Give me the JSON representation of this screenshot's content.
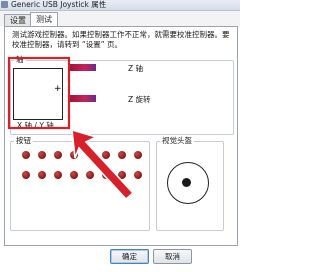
{
  "window": {
    "title": "Generic  USB  Joystick  属性",
    "icon": "gamepad-icon"
  },
  "tabs": [
    {
      "label": "设置",
      "active": false
    },
    {
      "label": "测试",
      "active": true
    }
  ],
  "intro_text": "测试游戏控制器。如果控制器工作不正常，就需要校准控制器。要校准控制器，请转到 “设置” 页。",
  "axes_group": {
    "label": "轴",
    "xy_label": "X 轴 / Y 轴",
    "crosshair": "+",
    "bars": [
      {
        "label": "Z 轴"
      },
      {
        "label": "Z 旋转"
      }
    ]
  },
  "buttons_group": {
    "label": "按钮",
    "button_count": 16
  },
  "pov_group": {
    "label": "视觉头盔"
  },
  "footer": {
    "ok_label": "确定",
    "cancel_label": "取消"
  },
  "colors": {
    "annotation": "#d8202a",
    "bar_start": "#9b1236",
    "bar_end": "#6d2a8a",
    "button_dot": "#8a1515"
  }
}
